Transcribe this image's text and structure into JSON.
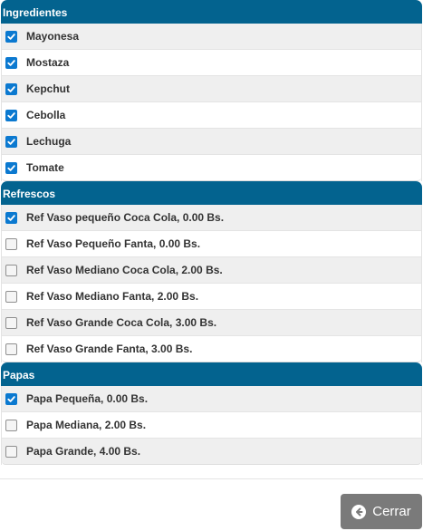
{
  "sections": [
    {
      "title": "Ingredientes",
      "items": [
        {
          "label": "Mayonesa",
          "checked": true
        },
        {
          "label": "Mostaza",
          "checked": true
        },
        {
          "label": "Kepchut",
          "checked": true
        },
        {
          "label": "Cebolla",
          "checked": true
        },
        {
          "label": "Lechuga",
          "checked": true
        },
        {
          "label": "Tomate",
          "checked": true
        }
      ]
    },
    {
      "title": "Refrescos",
      "items": [
        {
          "label": "Ref Vaso pequeño Coca Cola, 0.00 Bs.",
          "checked": true
        },
        {
          "label": "Ref Vaso Pequeño Fanta, 0.00 Bs.",
          "checked": false
        },
        {
          "label": "Ref Vaso Mediano Coca Cola, 2.00 Bs.",
          "checked": false
        },
        {
          "label": "Ref Vaso Mediano Fanta, 2.00 Bs.",
          "checked": false
        },
        {
          "label": "Ref Vaso Grande Coca Cola, 3.00 Bs.",
          "checked": false
        },
        {
          "label": "Ref Vaso Grande Fanta, 3.00 Bs.",
          "checked": false
        }
      ]
    },
    {
      "title": "Papas",
      "items": [
        {
          "label": "Papa Pequeña, 0.00 Bs.",
          "checked": true
        },
        {
          "label": "Papa Mediana, 2.00 Bs.",
          "checked": false
        },
        {
          "label": "Papa Grande, 4.00 Bs.",
          "checked": false
        }
      ]
    }
  ],
  "footer": {
    "close_label": "Cerrar",
    "close_icon": "arrow-left-circle-icon"
  },
  "colors": {
    "header_bg": "#03638f",
    "checkbox_checked": "#0b79d0",
    "button_bg": "#7a7a7a"
  }
}
